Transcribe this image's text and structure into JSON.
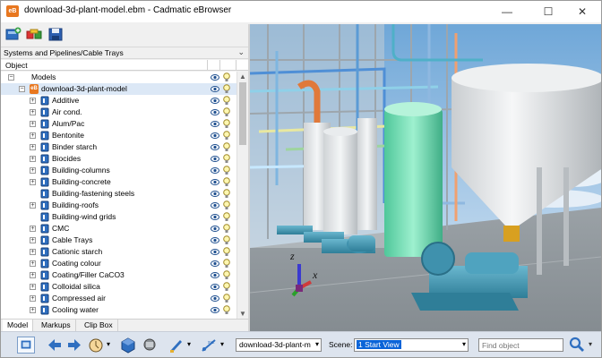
{
  "window": {
    "title": "download-3d-plant-model.ebm - Cadmatic eBrowser",
    "app_icon_text": "eB",
    "minimize_glyph": "—",
    "maximize_glyph": "☐",
    "close_glyph": "✕"
  },
  "toolbar_top": {
    "buttons": [
      "add-model-icon",
      "compare-icon",
      "save-icon"
    ]
  },
  "panel": {
    "title": "Systems and Pipelines/Cable Trays",
    "chevron": "⌄",
    "column_header": "Object"
  },
  "tree": {
    "root": {
      "label": "Models",
      "expander": "−"
    },
    "model": {
      "label": "download-3d-plant-model",
      "expander": "−",
      "icon_text": "eB"
    },
    "items": [
      {
        "label": "Additive",
        "expander": "+"
      },
      {
        "label": "Air cond.",
        "expander": "+"
      },
      {
        "label": "Alum/Pac",
        "expander": "+"
      },
      {
        "label": "Bentonite",
        "expander": "+"
      },
      {
        "label": "Binder starch",
        "expander": "+"
      },
      {
        "label": "Biocides",
        "expander": "+"
      },
      {
        "label": "Building-columns",
        "expander": "+"
      },
      {
        "label": "Building-concrete",
        "expander": "+"
      },
      {
        "label": "Building-fastening steels",
        "expander": ""
      },
      {
        "label": "Building-roofs",
        "expander": "+"
      },
      {
        "label": "Building-wind grids",
        "expander": ""
      },
      {
        "label": "CMC",
        "expander": "+"
      },
      {
        "label": "Cable Trays",
        "expander": "+"
      },
      {
        "label": "Cationic starch",
        "expander": "+"
      },
      {
        "label": "Coating colour",
        "expander": "+"
      },
      {
        "label": "Coating/Filler CaCO3",
        "expander": "+"
      },
      {
        "label": "Colloidal silica",
        "expander": "+"
      },
      {
        "label": "Compressed air",
        "expander": "+"
      },
      {
        "label": "Cooling water",
        "expander": "+"
      }
    ]
  },
  "bottom_tabs": [
    {
      "label": "Model",
      "active": true
    },
    {
      "label": "Markups",
      "active": false
    },
    {
      "label": "Clip Box",
      "active": false
    }
  ],
  "viewport": {
    "axis_z_label": "z",
    "axis_x_label": "x"
  },
  "status_bar": {
    "model_select_value": "download-3d-plant-m",
    "scene_label": "Scene:",
    "scene_value": "1 Start View",
    "find_placeholder": "Find object",
    "dropdown_glyph": "▾"
  },
  "colors": {
    "accent": "#0a64d8",
    "selection": "#dce8f6",
    "status_bar": "#dde4ee",
    "app_icon": "#e8771f"
  }
}
